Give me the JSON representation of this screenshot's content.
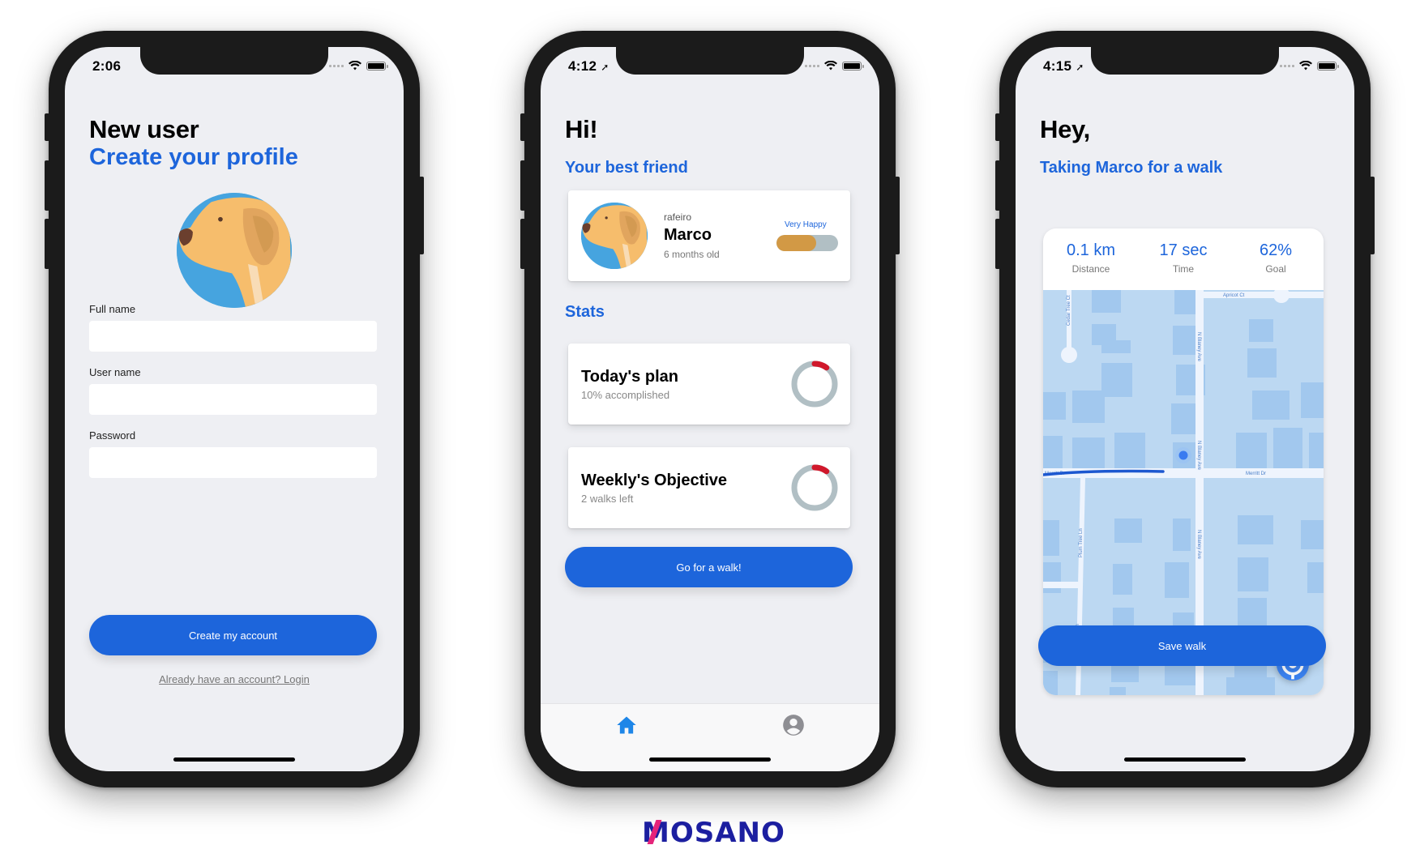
{
  "screens": {
    "signup": {
      "status_time": "2:06",
      "title": "New user",
      "subtitle": "Create your profile",
      "fields": [
        {
          "label": "Full name",
          "value": "",
          "placeholder": ""
        },
        {
          "label": "User name",
          "value": "",
          "placeholder": ""
        },
        {
          "label": "Password",
          "value": "",
          "placeholder": ""
        }
      ],
      "create_button": "Create my account",
      "login_link": "Already have an account? Login"
    },
    "home": {
      "status_time": "4:12",
      "title": "Hi!",
      "friend_heading": "Your best friend",
      "pet": {
        "breed": "rafeiro",
        "name": "Marco",
        "age": "6 months old",
        "mood_label": "Very Happy",
        "mood_level": 0.65
      },
      "stats_heading": "Stats",
      "stats": [
        {
          "title": "Today's plan",
          "subtitle": "10% accomplished",
          "progress": 0.1
        },
        {
          "title": "Weekly's Objective",
          "subtitle": "2 walks left",
          "progress": 0.1
        }
      ],
      "walk_button": "Go for a walk!",
      "tabs": [
        {
          "name": "home",
          "icon": "home-icon",
          "active": true
        },
        {
          "name": "profile",
          "icon": "user-circle-icon",
          "active": false
        }
      ]
    },
    "walk": {
      "status_time": "4:15",
      "title": "Hey,",
      "subtitle": "Taking Marco for a walk",
      "metrics": [
        {
          "value": "0.1 km",
          "label": "Distance"
        },
        {
          "value": "17 sec",
          "label": "Time"
        },
        {
          "value": "62%",
          "label": "Goal"
        }
      ],
      "map_streets": [
        "Apricot Ct",
        "Cedar Tree Ct",
        "N Blaney Ave",
        "Merritt Dr",
        "Plum Tree Ln"
      ],
      "save_button": "Save walk"
    }
  },
  "brand": {
    "logo_text": "OSANO",
    "logo_mark": "M",
    "primary_color": "#1d65db",
    "logo_color": "#1c1fa0",
    "logo_accent": "#e5247a"
  }
}
